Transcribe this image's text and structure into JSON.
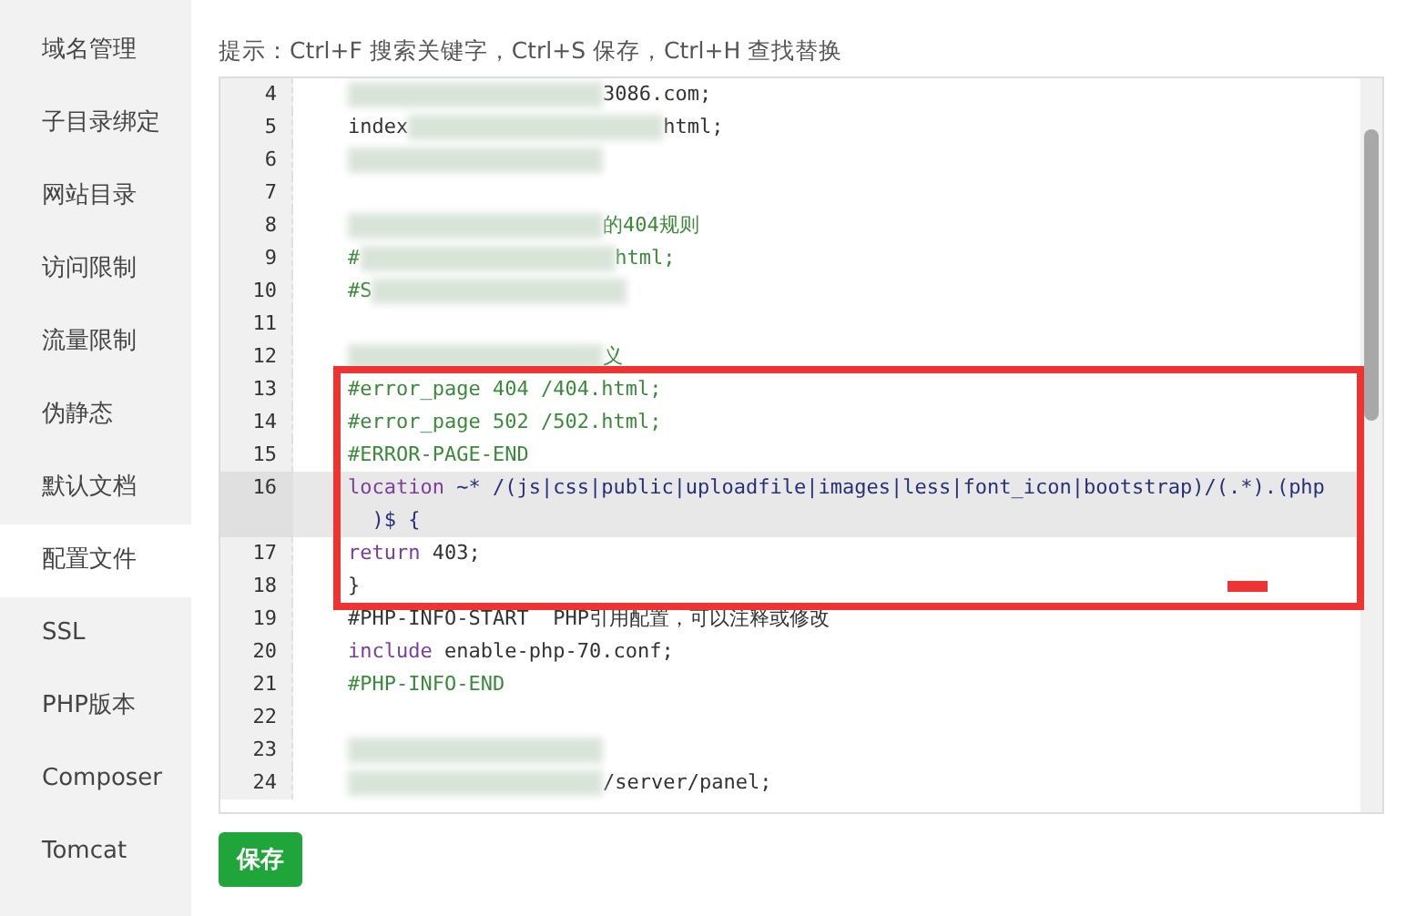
{
  "sidebar": {
    "items": [
      {
        "label": "域名管理",
        "selected": false
      },
      {
        "label": "子目录绑定",
        "selected": false
      },
      {
        "label": "网站目录",
        "selected": false
      },
      {
        "label": "访问限制",
        "selected": false
      },
      {
        "label": "流量限制",
        "selected": false
      },
      {
        "label": "伪静态",
        "selected": false
      },
      {
        "label": "默认文档",
        "selected": false
      },
      {
        "label": "配置文件",
        "selected": true
      },
      {
        "label": "SSL",
        "selected": false
      },
      {
        "label": "PHP版本",
        "selected": false
      },
      {
        "label": "Composer",
        "selected": false
      },
      {
        "label": "Tomcat",
        "selected": false
      }
    ]
  },
  "hint": "提示：Ctrl+F 搜索关键字，Ctrl+S 保存，Ctrl+H 查找替换",
  "editor": {
    "lines": [
      {
        "num": "4",
        "active": false,
        "parts": [
          {
            "kind": "blur"
          },
          {
            "kind": "plain",
            "text": "3086.com;"
          }
        ]
      },
      {
        "num": "5",
        "active": false,
        "parts": [
          {
            "kind": "plain",
            "text": "index"
          },
          {
            "kind": "blur"
          },
          {
            "kind": "plain",
            "text": "html;"
          }
        ]
      },
      {
        "num": "6",
        "active": false,
        "parts": [
          {
            "kind": "blur"
          }
        ]
      },
      {
        "num": "7",
        "active": false
      },
      {
        "num": "8",
        "active": false,
        "parts": [
          {
            "kind": "blur"
          },
          {
            "kind": "comment",
            "text": "的404规则"
          }
        ]
      },
      {
        "num": "9",
        "active": false,
        "parts": [
          {
            "kind": "comment",
            "text": "#"
          },
          {
            "kind": "blur"
          },
          {
            "kind": "comment",
            "text": "html;"
          }
        ]
      },
      {
        "num": "10",
        "active": false,
        "parts": [
          {
            "kind": "comment",
            "text": "#S"
          },
          {
            "kind": "blur"
          }
        ]
      },
      {
        "num": "11",
        "active": false
      },
      {
        "num": "12",
        "active": false,
        "parts": [
          {
            "kind": "blur"
          },
          {
            "kind": "comment",
            "text": "义"
          }
        ]
      },
      {
        "num": "13",
        "active": false,
        "parts": [
          {
            "kind": "comment",
            "text": "#error_page 404 /404.html;"
          }
        ]
      },
      {
        "num": "14",
        "active": false,
        "parts": [
          {
            "kind": "comment",
            "text": "#error_page 502 /502.html;"
          }
        ]
      },
      {
        "num": "15",
        "active": false,
        "parts": [
          {
            "kind": "comment",
            "text": "#ERROR-PAGE-END"
          }
        ]
      },
      {
        "num": "16",
        "active": true,
        "parts": [
          {
            "kind": "keyword",
            "text": "location"
          },
          {
            "kind": "path",
            "text": " ~* /(js|css|public|uploadfile|images|less|font_icon|bootstrap)/(.*).(php"
          }
        ],
        "continuation": [
          {
            "kind": "path",
            "text": "  )$ {"
          }
        ]
      },
      {
        "num": "17",
        "active": false,
        "parts": [
          {
            "kind": "keyword",
            "text": "return"
          },
          {
            "kind": "plain",
            "text": " 403;"
          }
        ]
      },
      {
        "num": "18",
        "active": false,
        "parts": [
          {
            "kind": "plain",
            "text": "}"
          }
        ]
      },
      {
        "num": "19",
        "active": false,
        "parts": [
          {
            "kind": "plain",
            "text": "#PHP-INFO-START  PHP引用配置，可以注释或修改"
          }
        ]
      },
      {
        "num": "20",
        "active": false,
        "parts": [
          {
            "kind": "keyword",
            "text": "include"
          },
          {
            "kind": "plain",
            "text": " enable-php-70.conf;"
          }
        ]
      },
      {
        "num": "21",
        "active": false,
        "parts": [
          {
            "kind": "comment",
            "text": "#PHP-INFO-END"
          }
        ]
      },
      {
        "num": "22",
        "active": false
      },
      {
        "num": "23",
        "active": false,
        "parts": [
          {
            "kind": "blur"
          }
        ]
      },
      {
        "num": "24",
        "active": false,
        "parts": [
          {
            "kind": "blur"
          },
          {
            "kind": "plain",
            "text": "/server/panel;"
          }
        ]
      }
    ]
  },
  "save_button": "保存"
}
